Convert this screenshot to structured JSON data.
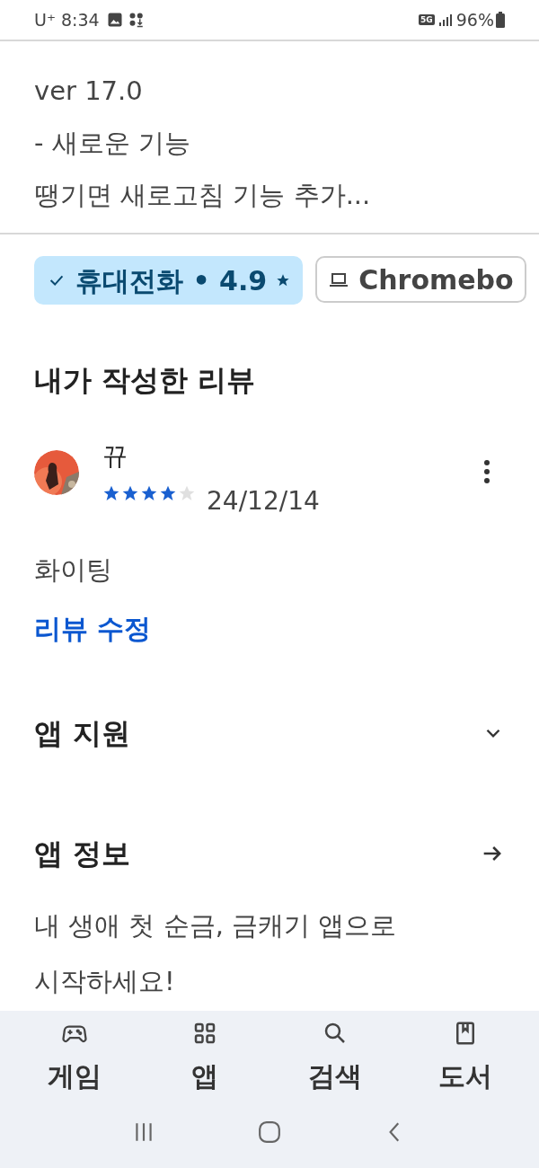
{
  "status_bar": {
    "carrier": "U⁺",
    "time": "8:34",
    "network": "5G",
    "battery": "96%"
  },
  "whats_new": [
    "ver 17.0",
    "- 새로운 기능",
    "땡기면 새로고침 기능 추가..."
  ],
  "device_chips": [
    {
      "label": "휴대전화 • 4.9",
      "kind": "phone",
      "selected": true
    },
    {
      "label": "Chromebo",
      "kind": "laptop",
      "selected": false
    }
  ],
  "my_review": {
    "title": "내가 작성한 리뷰",
    "author": "뀨",
    "stars": 4,
    "date": "24/12/14",
    "text": "화이팅",
    "edit_link": "리뷰 수정"
  },
  "sections": [
    {
      "title": "앱 지원",
      "kind": "expand"
    },
    {
      "title": "앱 정보",
      "kind": "navigate"
    }
  ],
  "description": [
    "내 생애 첫 순금, 금캐기 앱으로",
    "시작하세요!"
  ],
  "bottom_nav": [
    {
      "label": "게임",
      "kind": "games"
    },
    {
      "label": "앱",
      "kind": "apps"
    },
    {
      "label": "검색",
      "kind": "search"
    },
    {
      "label": "도서",
      "kind": "books"
    }
  ]
}
